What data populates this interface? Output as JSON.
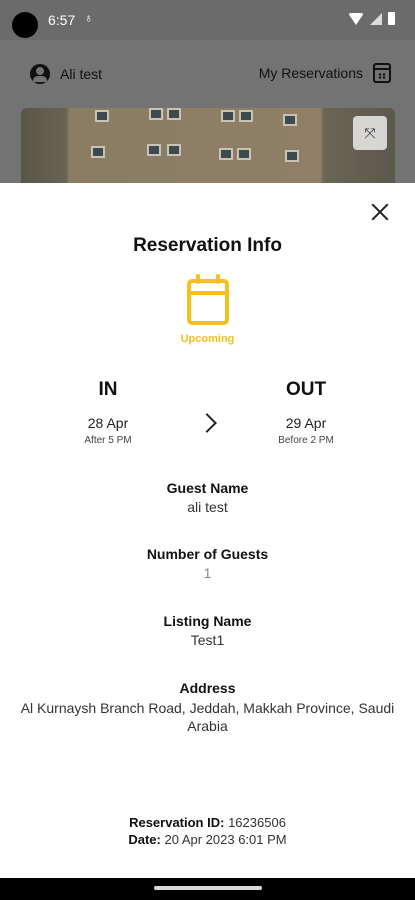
{
  "status_bar": {
    "time": "6:57"
  },
  "header": {
    "user_name": "Ali test",
    "my_reservations": "My Reservations"
  },
  "sheet": {
    "title": "Reservation Info",
    "status": "Upcoming",
    "status_color": "#f6bf1e",
    "check_in": {
      "label": "IN",
      "date": "28 Apr",
      "time": "After 5 PM"
    },
    "check_out": {
      "label": "OUT",
      "date": "29 Apr",
      "time": "Before 2 PM"
    },
    "fields": {
      "guest_name": {
        "label": "Guest Name",
        "value": "ali test"
      },
      "guests": {
        "label": "Number of Guests",
        "value": "1"
      },
      "listing": {
        "label": "Listing Name",
        "value": "Test1"
      },
      "address": {
        "label": "Address",
        "value": "Al Kurnaysh Branch Road, Jeddah, Makkah Province, Saudi Arabia"
      }
    },
    "footer": {
      "reservation_id_label": "Reservation ID:",
      "reservation_id": "16236506",
      "date_label": "Date:",
      "date": "20 Apr 2023 6:01 PM"
    }
  }
}
